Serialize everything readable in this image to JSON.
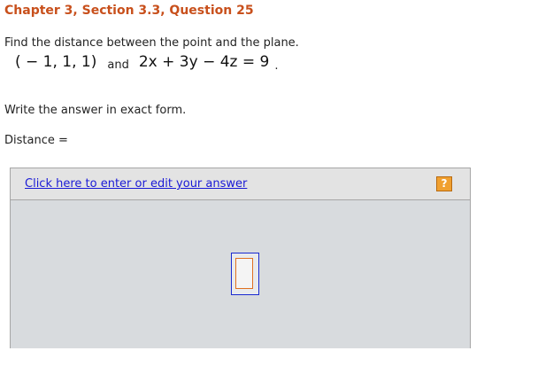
{
  "question": {
    "title": "Chapter 3, Section 3.3, Question 25",
    "prompt": "Find the distance between the point and the plane.",
    "point": "( − 1, 1, 1)",
    "connector": "and",
    "plane": "2x + 3y − 4z = 9",
    "period": ".",
    "instruction": "Write the answer in exact form.",
    "answer_label": "Distance ="
  },
  "answer_panel": {
    "edit_link": "Click here to enter or edit your answer",
    "help_label": "?",
    "help_icon": "question-mark-icon",
    "value": ""
  },
  "colors": {
    "title": "#c8501c",
    "link": "#1a1ad6",
    "panel_bg": "#d8dbde",
    "help_bg": "#f0a030",
    "input_border_outer": "#1a2ad0",
    "input_border_inner": "#e07020"
  }
}
